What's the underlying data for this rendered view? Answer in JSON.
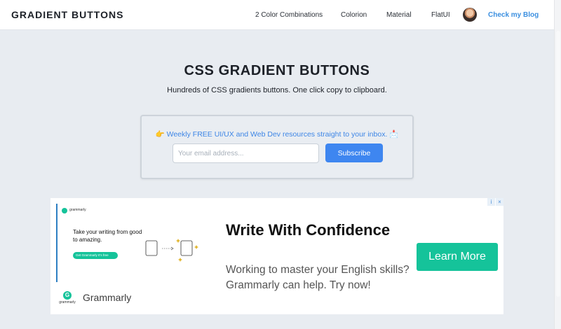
{
  "nav": {
    "brand": "GRADIENT BUTTONS",
    "links": [
      "2 Color Combinations",
      "Colorion",
      "Material",
      "FlatUI"
    ],
    "blog": "Check my Blog"
  },
  "hero": {
    "title": "CSS GRADIENT BUTTONS",
    "subtitle": "Hundreds of CSS gradients buttons. One click copy to clipboard."
  },
  "newsletter": {
    "lead_emoji": "👉",
    "text": "Weekly FREE UI/UX and Web Dev resources straight to your inbox.",
    "trail_emoji": "📩",
    "email_placeholder": "Your email address...",
    "email_value": "",
    "subscribe_label": "Subscribe"
  },
  "ad": {
    "small_brand": "grammarly",
    "small_headline": "Take your writing from good to amazing.",
    "small_cta": "Get Grammarly  It's free",
    "brand_word": "grammarly",
    "brand_name": "Grammarly",
    "headline": "Write With Confidence",
    "body": "Working to master your English skills? Grammarly can help. Try now!",
    "cta": "Learn More",
    "badge_info": "i",
    "badge_close": "×"
  },
  "colors": {
    "accent_blue": "#3e86f0",
    "grammarly_green": "#15c39a",
    "page_bg": "#e8ecf1"
  }
}
